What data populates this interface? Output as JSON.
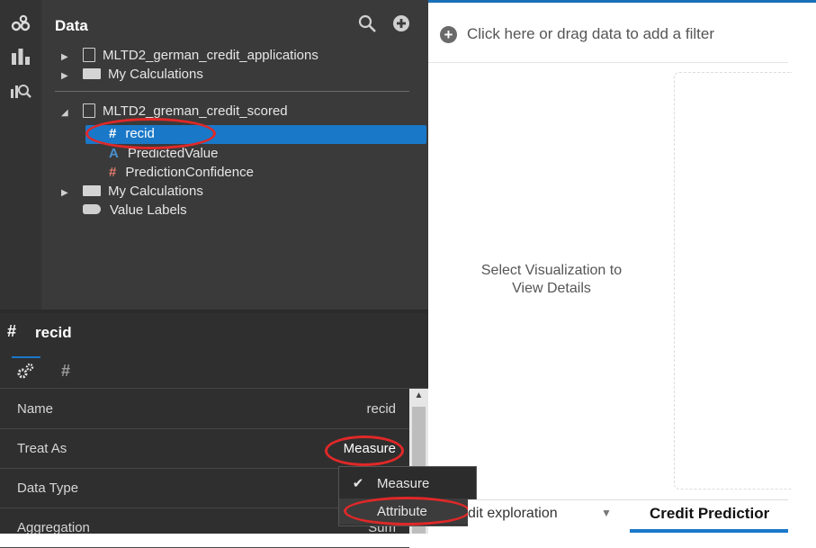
{
  "data_panel": {
    "title": "Data",
    "tree": {
      "ds1_name": "MLTD2_german_credit_applications",
      "ds1_calc": "My Calculations",
      "ds2_name": "MLTD2_greman_credit_scored",
      "col_recid": "recid",
      "col_predicted": "PredictedValue",
      "col_confidence": "PredictionConfidence",
      "ds2_calc": "My Calculations",
      "value_labels": "Value Labels"
    }
  },
  "properties": {
    "title": "recid",
    "rows": [
      {
        "name": "Name",
        "value": "recid"
      },
      {
        "name": "Treat As",
        "value": "Measure"
      },
      {
        "name": "Data Type",
        "value": ""
      },
      {
        "name": "Aggregation",
        "value": "Sum"
      }
    ]
  },
  "treat_as_menu": {
    "items": [
      "Measure",
      "Attribute"
    ],
    "checked": "Measure"
  },
  "canvas": {
    "filter_prompt": "Click here or drag data to add a filter",
    "placeholder_line1": "Select Visualization to",
    "placeholder_line2": "View Details"
  },
  "canvas_tabs": [
    "dit exploration",
    "Credit Predictior"
  ],
  "colors": {
    "accent": "#1a78c8",
    "highlight_ring": "#e02828",
    "measure_icon": "#e07a6a",
    "attribute_icon": "#4a90d0"
  }
}
